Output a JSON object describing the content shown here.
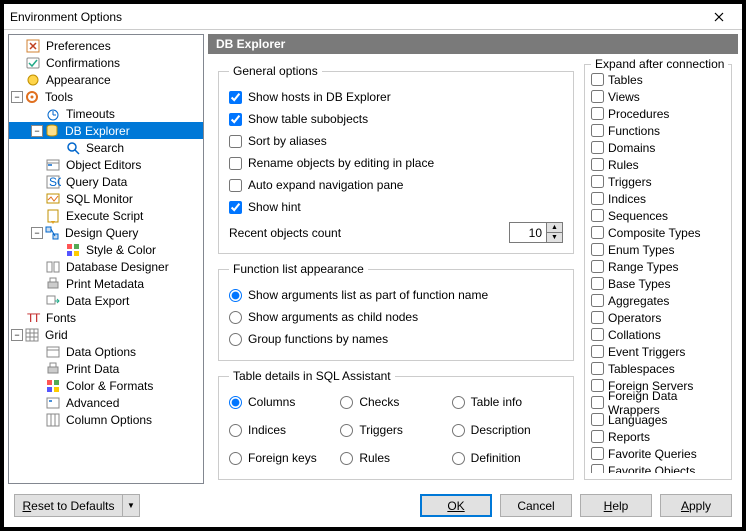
{
  "window": {
    "title": "Environment Options"
  },
  "tree": {
    "preferences": "Preferences",
    "confirmations": "Confirmations",
    "appearance": "Appearance",
    "tools": "Tools",
    "timeouts": "Timeouts",
    "db_explorer": "DB Explorer",
    "search": "Search",
    "object_editors": "Object Editors",
    "query_data": "Query Data",
    "sql_monitor": "SQL Monitor",
    "execute_script": "Execute Script",
    "design_query": "Design Query",
    "style_color": "Style & Color",
    "database_designer": "Database Designer",
    "print_metadata": "Print Metadata",
    "data_export": "Data Export",
    "fonts": "Fonts",
    "grid": "Grid",
    "data_options": "Data Options",
    "print_data": "Print Data",
    "color_formats": "Color & Formats",
    "advanced": "Advanced",
    "column_options": "Column Options"
  },
  "panel": {
    "title": "DB Explorer"
  },
  "general": {
    "legend": "General options",
    "show_hosts": "Show hosts in DB Explorer",
    "show_subobjects": "Show table subobjects",
    "sort_aliases": "Sort by aliases",
    "rename_in_place": "Rename objects by editing in place",
    "auto_expand": "Auto expand navigation pane",
    "show_hint": "Show hint",
    "recent_label": "Recent objects count",
    "recent_value": "10"
  },
  "fnlist": {
    "legend": "Function list appearance",
    "opt1": "Show arguments list as part of function name",
    "opt2": "Show arguments as child nodes",
    "opt3": "Group functions by names"
  },
  "details": {
    "legend": "Table details in SQL Assistant",
    "columns": "Columns",
    "checks": "Checks",
    "table_info": "Table info",
    "indices": "Indices",
    "triggers": "Triggers",
    "description": "Description",
    "foreign_keys": "Foreign keys",
    "rules": "Rules",
    "definition": "Definition"
  },
  "expand": {
    "title": "Expand after connection",
    "items": [
      "Tables",
      "Views",
      "Procedures",
      "Functions",
      "Domains",
      "Rules",
      "Triggers",
      "Indices",
      "Sequences",
      "Composite Types",
      "Enum Types",
      "Range Types",
      "Base Types",
      "Aggregates",
      "Operators",
      "Collations",
      "Event Triggers",
      "Tablespaces",
      "Foreign Servers",
      "Foreign Data Wrappers",
      "Languages",
      "Reports",
      "Favorite Queries",
      "Favorite Objects"
    ]
  },
  "footer": {
    "reset": "Reset to Defaults",
    "ok": "OK",
    "cancel": "Cancel",
    "help": "Help",
    "apply": "Apply"
  }
}
